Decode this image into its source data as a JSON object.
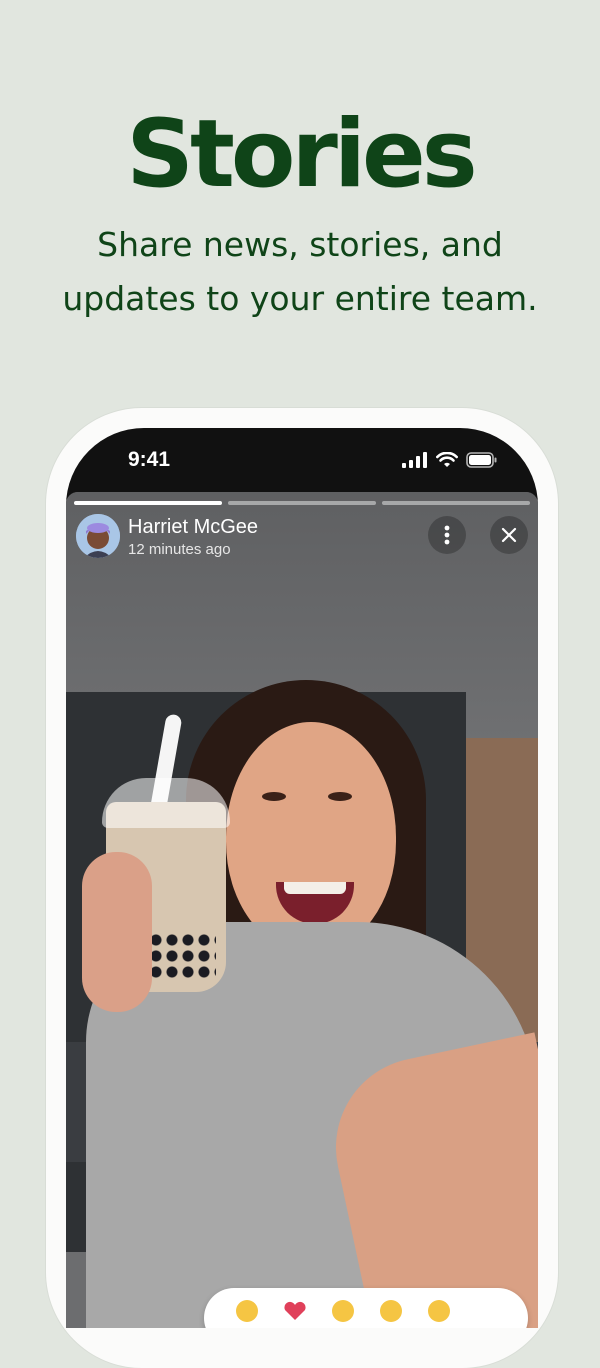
{
  "promo": {
    "headline": "Stories",
    "subheadline": "Share news, stories, and updates to your entire team."
  },
  "status_bar": {
    "time": "9:41"
  },
  "story": {
    "progress": {
      "segments": 3,
      "active_index": 0
    },
    "author": {
      "name": "Harriet McGee",
      "posted_ago": "12 minutes ago"
    }
  },
  "icons": {
    "more": "more-vertical-icon",
    "close": "close-icon",
    "signal": "cellular-signal-icon",
    "wifi": "wifi-icon",
    "battery": "battery-icon"
  },
  "colors": {
    "background": "#e1e6df",
    "brand_green": "#0f4418"
  }
}
